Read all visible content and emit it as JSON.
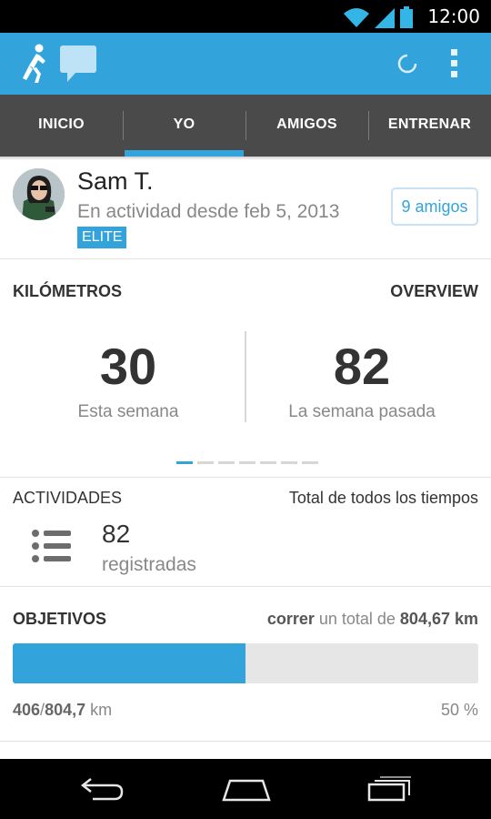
{
  "status_bar": {
    "time": "12:00"
  },
  "tabs": [
    {
      "label": "INICIO"
    },
    {
      "label": "YO"
    },
    {
      "label": "AMIGOS"
    },
    {
      "label": "ENTRENAR"
    }
  ],
  "profile": {
    "name": "Sam T.",
    "since": "En actividad desde feb 5, 2013",
    "badge": "ELITE",
    "friends_button": "9 amigos"
  },
  "kilometers": {
    "title": "KILÓMETROS",
    "overview": "OVERVIEW",
    "this_week_value": "30",
    "this_week_label": "Esta semana",
    "last_week_value": "82",
    "last_week_label": "La semana pasada",
    "pager_pages": 7,
    "pager_active": 0
  },
  "activities": {
    "title": "ACTIVIDADES",
    "range": "Total de todos los tiempos",
    "count": "82",
    "count_label": "registradas"
  },
  "goals": {
    "title": "OBJETIVOS",
    "desc_verb": "correr",
    "desc_middle": " un total de ",
    "desc_target": "804,67 km",
    "progress_fraction": 0.5,
    "done": "406",
    "sep": "/",
    "target": "804,7",
    "unit": " km",
    "percent": "50 %"
  },
  "colors": {
    "accent": "#33a3dc",
    "tab_bar": "#4a4a4a"
  }
}
